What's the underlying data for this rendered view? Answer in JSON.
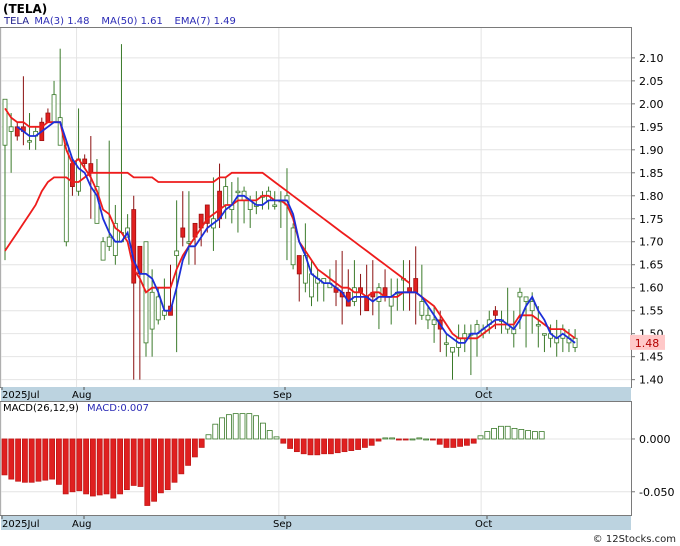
{
  "chart_data": [
    {
      "type": "candlestick",
      "ticker_label": "(TELA)",
      "legend": [
        {
          "label": "TELA",
          "color": "#1b1b8a"
        },
        {
          "label": "MA(3)",
          "value": "1.48",
          "color": "#2b2bb5"
        },
        {
          "label": "MA(50)",
          "value": "1.61",
          "color": "#2b2bb5"
        },
        {
          "label": "EMA(7)",
          "value": "1.49",
          "color": "#2b2bb5"
        }
      ],
      "last_price_label": "1.48",
      "y_ticks": [
        "2.10",
        "2.05",
        "2.00",
        "1.95",
        "1.90",
        "1.85",
        "1.80",
        "1.75",
        "1.70",
        "1.65",
        "1.60",
        "1.55",
        "1.50",
        "1.45",
        "1.40"
      ],
      "ylim": [
        1.384,
        2.165
      ],
      "x_labels": [
        "2025Jul",
        "Aug",
        "Sep",
        "Oct"
      ],
      "candles": [
        [
          1.91,
          2.01,
          1.99,
          1.66
        ],
        [
          1.94,
          1.95,
          1.98,
          1.85
        ],
        [
          1.95,
          1.93,
          1.96,
          1.92
        ],
        [
          1.95,
          1.94,
          2.06,
          1.91
        ],
        [
          1.92,
          1.92,
          1.98,
          1.9
        ],
        [
          1.93,
          1.94,
          1.95,
          1.9
        ],
        [
          1.96,
          1.92,
          1.97,
          1.92
        ],
        [
          1.98,
          1.96,
          1.99,
          1.96
        ],
        [
          1.96,
          2.02,
          2.05,
          1.96
        ],
        [
          1.91,
          1.97,
          2.12,
          1.91
        ],
        [
          1.7,
          1.91,
          1.92,
          1.69
        ],
        [
          1.87,
          1.82,
          1.88,
          1.8
        ],
        [
          1.81,
          1.88,
          1.99,
          1.8
        ],
        [
          1.88,
          1.87,
          1.89,
          1.86
        ],
        [
          1.87,
          1.85,
          1.93,
          1.75
        ],
        [
          1.74,
          1.82,
          1.88,
          1.74
        ],
        [
          1.66,
          1.7,
          1.71,
          1.66
        ],
        [
          1.69,
          1.71,
          1.92,
          1.68
        ],
        [
          1.67,
          1.74,
          1.78,
          1.65
        ],
        [
          1.7,
          1.72,
          2.13,
          1.7
        ],
        [
          1.71,
          1.73,
          1.76,
          1.71
        ],
        [
          1.77,
          1.61,
          1.8,
          1.4
        ],
        [
          1.69,
          1.63,
          1.69,
          1.4
        ],
        [
          1.48,
          1.7,
          1.7,
          1.45
        ],
        [
          1.51,
          1.59,
          1.64,
          1.45
        ],
        [
          1.53,
          1.58,
          1.6,
          1.52
        ],
        [
          1.54,
          1.55,
          1.62,
          1.53
        ],
        [
          1.56,
          1.54,
          1.65,
          1.54
        ],
        [
          1.67,
          1.68,
          1.79,
          1.46
        ],
        [
          1.73,
          1.71,
          1.81,
          1.69
        ],
        [
          1.7,
          1.7,
          1.81,
          1.65
        ],
        [
          1.74,
          1.71,
          1.74,
          1.65
        ],
        [
          1.76,
          1.73,
          1.76,
          1.69
        ],
        [
          1.78,
          1.74,
          1.78,
          1.72
        ],
        [
          1.73,
          1.75,
          1.84,
          1.68
        ],
        [
          1.81,
          1.75,
          1.87,
          1.73
        ],
        [
          1.78,
          1.82,
          1.84,
          1.75
        ],
        [
          1.77,
          1.78,
          1.83,
          1.74
        ],
        [
          1.81,
          1.81,
          1.84,
          1.72
        ],
        [
          1.79,
          1.81,
          1.82,
          1.74
        ],
        [
          1.77,
          1.79,
          1.8,
          1.73
        ],
        [
          1.78,
          1.78,
          1.81,
          1.76
        ],
        [
          1.8,
          1.8,
          1.81,
          1.77
        ],
        [
          1.79,
          1.81,
          1.82,
          1.77
        ],
        [
          1.78,
          1.78,
          1.81,
          1.77
        ],
        [
          1.79,
          1.79,
          1.81,
          1.73
        ],
        [
          1.78,
          1.8,
          1.86,
          1.66
        ],
        [
          1.65,
          1.73,
          1.74,
          1.64
        ],
        [
          1.67,
          1.63,
          1.67,
          1.57
        ],
        [
          1.61,
          1.67,
          1.74,
          1.59
        ],
        [
          1.58,
          1.63,
          1.66,
          1.56
        ],
        [
          1.61,
          1.62,
          1.64,
          1.57
        ],
        [
          1.61,
          1.62,
          1.62,
          1.57
        ],
        [
          1.6,
          1.61,
          1.64,
          1.6
        ],
        [
          1.6,
          1.59,
          1.66,
          1.56
        ],
        [
          1.59,
          1.58,
          1.68,
          1.52
        ],
        [
          1.59,
          1.56,
          1.64,
          1.56
        ],
        [
          1.57,
          1.6,
          1.66,
          1.56
        ],
        [
          1.6,
          1.59,
          1.63,
          1.54
        ],
        [
          1.58,
          1.55,
          1.65,
          1.55
        ],
        [
          1.59,
          1.58,
          1.66,
          1.54
        ],
        [
          1.57,
          1.6,
          1.61,
          1.51
        ],
        [
          1.6,
          1.58,
          1.64,
          1.57
        ],
        [
          1.56,
          1.58,
          1.62,
          1.52
        ],
        [
          1.59,
          1.59,
          1.62,
          1.55
        ],
        [
          1.62,
          1.62,
          1.66,
          1.55
        ],
        [
          1.6,
          1.59,
          1.66,
          1.55
        ],
        [
          1.62,
          1.59,
          1.69,
          1.52
        ],
        [
          1.54,
          1.57,
          1.65,
          1.53
        ],
        [
          1.53,
          1.54,
          1.56,
          1.51
        ],
        [
          1.52,
          1.53,
          1.56,
          1.48
        ],
        [
          1.53,
          1.51,
          1.55,
          1.46
        ],
        [
          1.48,
          1.48,
          1.5,
          1.45
        ],
        [
          1.46,
          1.47,
          1.47,
          1.4
        ],
        [
          1.47,
          1.49,
          1.52,
          1.45
        ],
        [
          1.49,
          1.5,
          1.52,
          1.46
        ],
        [
          1.5,
          1.5,
          1.52,
          1.41
        ],
        [
          1.5,
          1.52,
          1.53,
          1.45
        ],
        [
          1.5,
          1.51,
          1.52,
          1.49
        ],
        [
          1.52,
          1.53,
          1.55,
          1.5
        ],
        [
          1.55,
          1.54,
          1.56,
          1.51
        ],
        [
          1.53,
          1.53,
          1.55,
          1.5
        ],
        [
          1.51,
          1.52,
          1.6,
          1.5
        ],
        [
          1.5,
          1.51,
          1.55,
          1.47
        ],
        [
          1.58,
          1.59,
          1.6,
          1.51
        ],
        [
          1.57,
          1.58,
          1.58,
          1.47
        ],
        [
          1.55,
          1.57,
          1.59,
          1.5
        ],
        [
          1.52,
          1.52,
          1.56,
          1.47
        ],
        [
          1.5,
          1.5,
          1.5,
          1.46
        ],
        [
          1.49,
          1.5,
          1.52,
          1.47
        ],
        [
          1.48,
          1.49,
          1.53,
          1.45
        ],
        [
          1.49,
          1.51,
          1.52,
          1.46
        ],
        [
          1.48,
          1.49,
          1.51,
          1.46
        ],
        [
          1.47,
          1.49,
          1.51,
          1.46
        ]
      ],
      "ma50": [
        1.68,
        1.7,
        1.72,
        1.74,
        1.76,
        1.78,
        1.81,
        1.83,
        1.84,
        1.84,
        1.84,
        1.83,
        1.83,
        1.84,
        1.85,
        1.85,
        1.85,
        1.85,
        1.85,
        1.85,
        1.85,
        1.84,
        1.84,
        1.84,
        1.84,
        1.83,
        1.83,
        1.83,
        1.83,
        1.83,
        1.83,
        1.83,
        1.83,
        1.83,
        1.83,
        1.84,
        1.84,
        1.85,
        1.85,
        1.85,
        1.85,
        1.85,
        1.85,
        1.84,
        1.83,
        1.82,
        1.81,
        1.8,
        1.79,
        1.78,
        1.77,
        1.76,
        1.75,
        1.74,
        1.73,
        1.72,
        1.71,
        1.7,
        1.69,
        1.68,
        1.67,
        1.66,
        1.65,
        1.64,
        1.63,
        1.62,
        1.61
      ],
      "ema7": [
        1.99,
        1.97,
        1.96,
        1.96,
        1.95,
        1.95,
        1.95,
        1.96,
        1.96,
        1.96,
        1.9,
        1.87,
        1.88,
        1.86,
        1.84,
        1.81,
        1.77,
        1.76,
        1.73,
        1.72,
        1.7,
        1.64,
        1.62,
        1.59,
        1.6,
        1.6,
        1.6,
        1.6,
        1.64,
        1.67,
        1.69,
        1.71,
        1.73,
        1.75,
        1.76,
        1.77,
        1.78,
        1.78,
        1.79,
        1.79,
        1.79,
        1.79,
        1.8,
        1.8,
        1.79,
        1.79,
        1.78,
        1.75,
        1.7,
        1.68,
        1.66,
        1.64,
        1.63,
        1.62,
        1.61,
        1.6,
        1.6,
        1.59,
        1.59,
        1.58,
        1.59,
        1.59,
        1.58,
        1.58,
        1.58,
        1.59,
        1.59,
        1.59,
        1.58,
        1.57,
        1.56,
        1.54,
        1.52,
        1.5,
        1.49,
        1.49,
        1.49,
        1.49,
        1.5,
        1.51,
        1.52,
        1.52,
        1.52,
        1.52,
        1.54,
        1.54,
        1.54,
        1.53,
        1.52,
        1.51,
        1.51,
        1.51,
        1.5,
        1.49
      ],
      "ma3": [
        null,
        null,
        1.95,
        1.94,
        1.93,
        1.93,
        1.94,
        1.95,
        1.96,
        1.96,
        1.92,
        1.88,
        1.86,
        1.85,
        1.82,
        1.8,
        1.75,
        1.72,
        1.7,
        1.7,
        1.72,
        1.66,
        1.63,
        1.63,
        1.62,
        1.59,
        1.55,
        1.55,
        1.6,
        1.66,
        1.69,
        1.69,
        1.71,
        1.73,
        1.74,
        1.75,
        1.77,
        1.78,
        1.8,
        1.8,
        1.79,
        1.78,
        1.78,
        1.79,
        1.79,
        1.79,
        1.79,
        1.76,
        1.7,
        1.67,
        1.63,
        1.62,
        1.61,
        1.61,
        1.6,
        1.59,
        1.57,
        1.58,
        1.58,
        1.58,
        1.57,
        1.58,
        1.58,
        1.58,
        1.59,
        1.59,
        1.59,
        1.59,
        1.58,
        1.56,
        1.54,
        1.52,
        1.5,
        1.49,
        1.48,
        1.48,
        1.5,
        1.5,
        1.51,
        1.52,
        1.53,
        1.53,
        1.52,
        1.51,
        1.53,
        1.56,
        1.58,
        1.55,
        1.53,
        1.5,
        1.49,
        1.5,
        1.49,
        1.48
      ]
    },
    {
      "type": "bar",
      "indicator_label": "MACD(26,12,9)",
      "value_label": "MACD:0.007",
      "y_ticks": [
        "0.000",
        "-0.050"
      ],
      "ylim": [
        -0.072,
        0.035
      ],
      "x_labels": [
        "2025Jul",
        "Aug",
        "Sep",
        "Oct"
      ],
      "values": [
        -0.034,
        -0.038,
        -0.04,
        -0.041,
        -0.041,
        -0.04,
        -0.039,
        -0.038,
        -0.043,
        -0.052,
        -0.05,
        -0.049,
        -0.052,
        -0.054,
        -0.053,
        -0.052,
        -0.056,
        -0.052,
        -0.048,
        -0.044,
        -0.045,
        -0.063,
        -0.059,
        -0.051,
        -0.048,
        -0.041,
        -0.033,
        -0.025,
        -0.017,
        -0.008,
        0.004,
        0.014,
        0.02,
        0.023,
        0.024,
        0.024,
        0.024,
        0.022,
        0.015,
        0.008,
        0.002,
        -0.004,
        -0.009,
        -0.012,
        -0.014,
        -0.015,
        -0.015,
        -0.014,
        -0.014,
        -0.013,
        -0.012,
        -0.011,
        -0.01,
        -0.008,
        -0.006,
        -0.002,
        0.001,
        0.001,
        -0.001,
        -0.001,
        0.0,
        0.001,
        0.0,
        -0.001,
        -0.005,
        -0.008,
        -0.008,
        -0.007,
        -0.006,
        -0.004,
        0.003,
        0.007,
        0.01,
        0.012,
        0.012,
        0.01,
        0.009,
        0.008,
        0.007,
        0.007
      ]
    }
  ],
  "colors": {
    "up": "#3a7a2a",
    "down": "#e02020",
    "ma": "#1c2ed8",
    "ma50": "#ee1c1c",
    "axisbar": "#bcd3e0",
    "price_tag_bg": "#ffc8c8",
    "price_tag_fg": "#b40000"
  },
  "footer": {
    "watermark": "© 12Stocks.com"
  }
}
